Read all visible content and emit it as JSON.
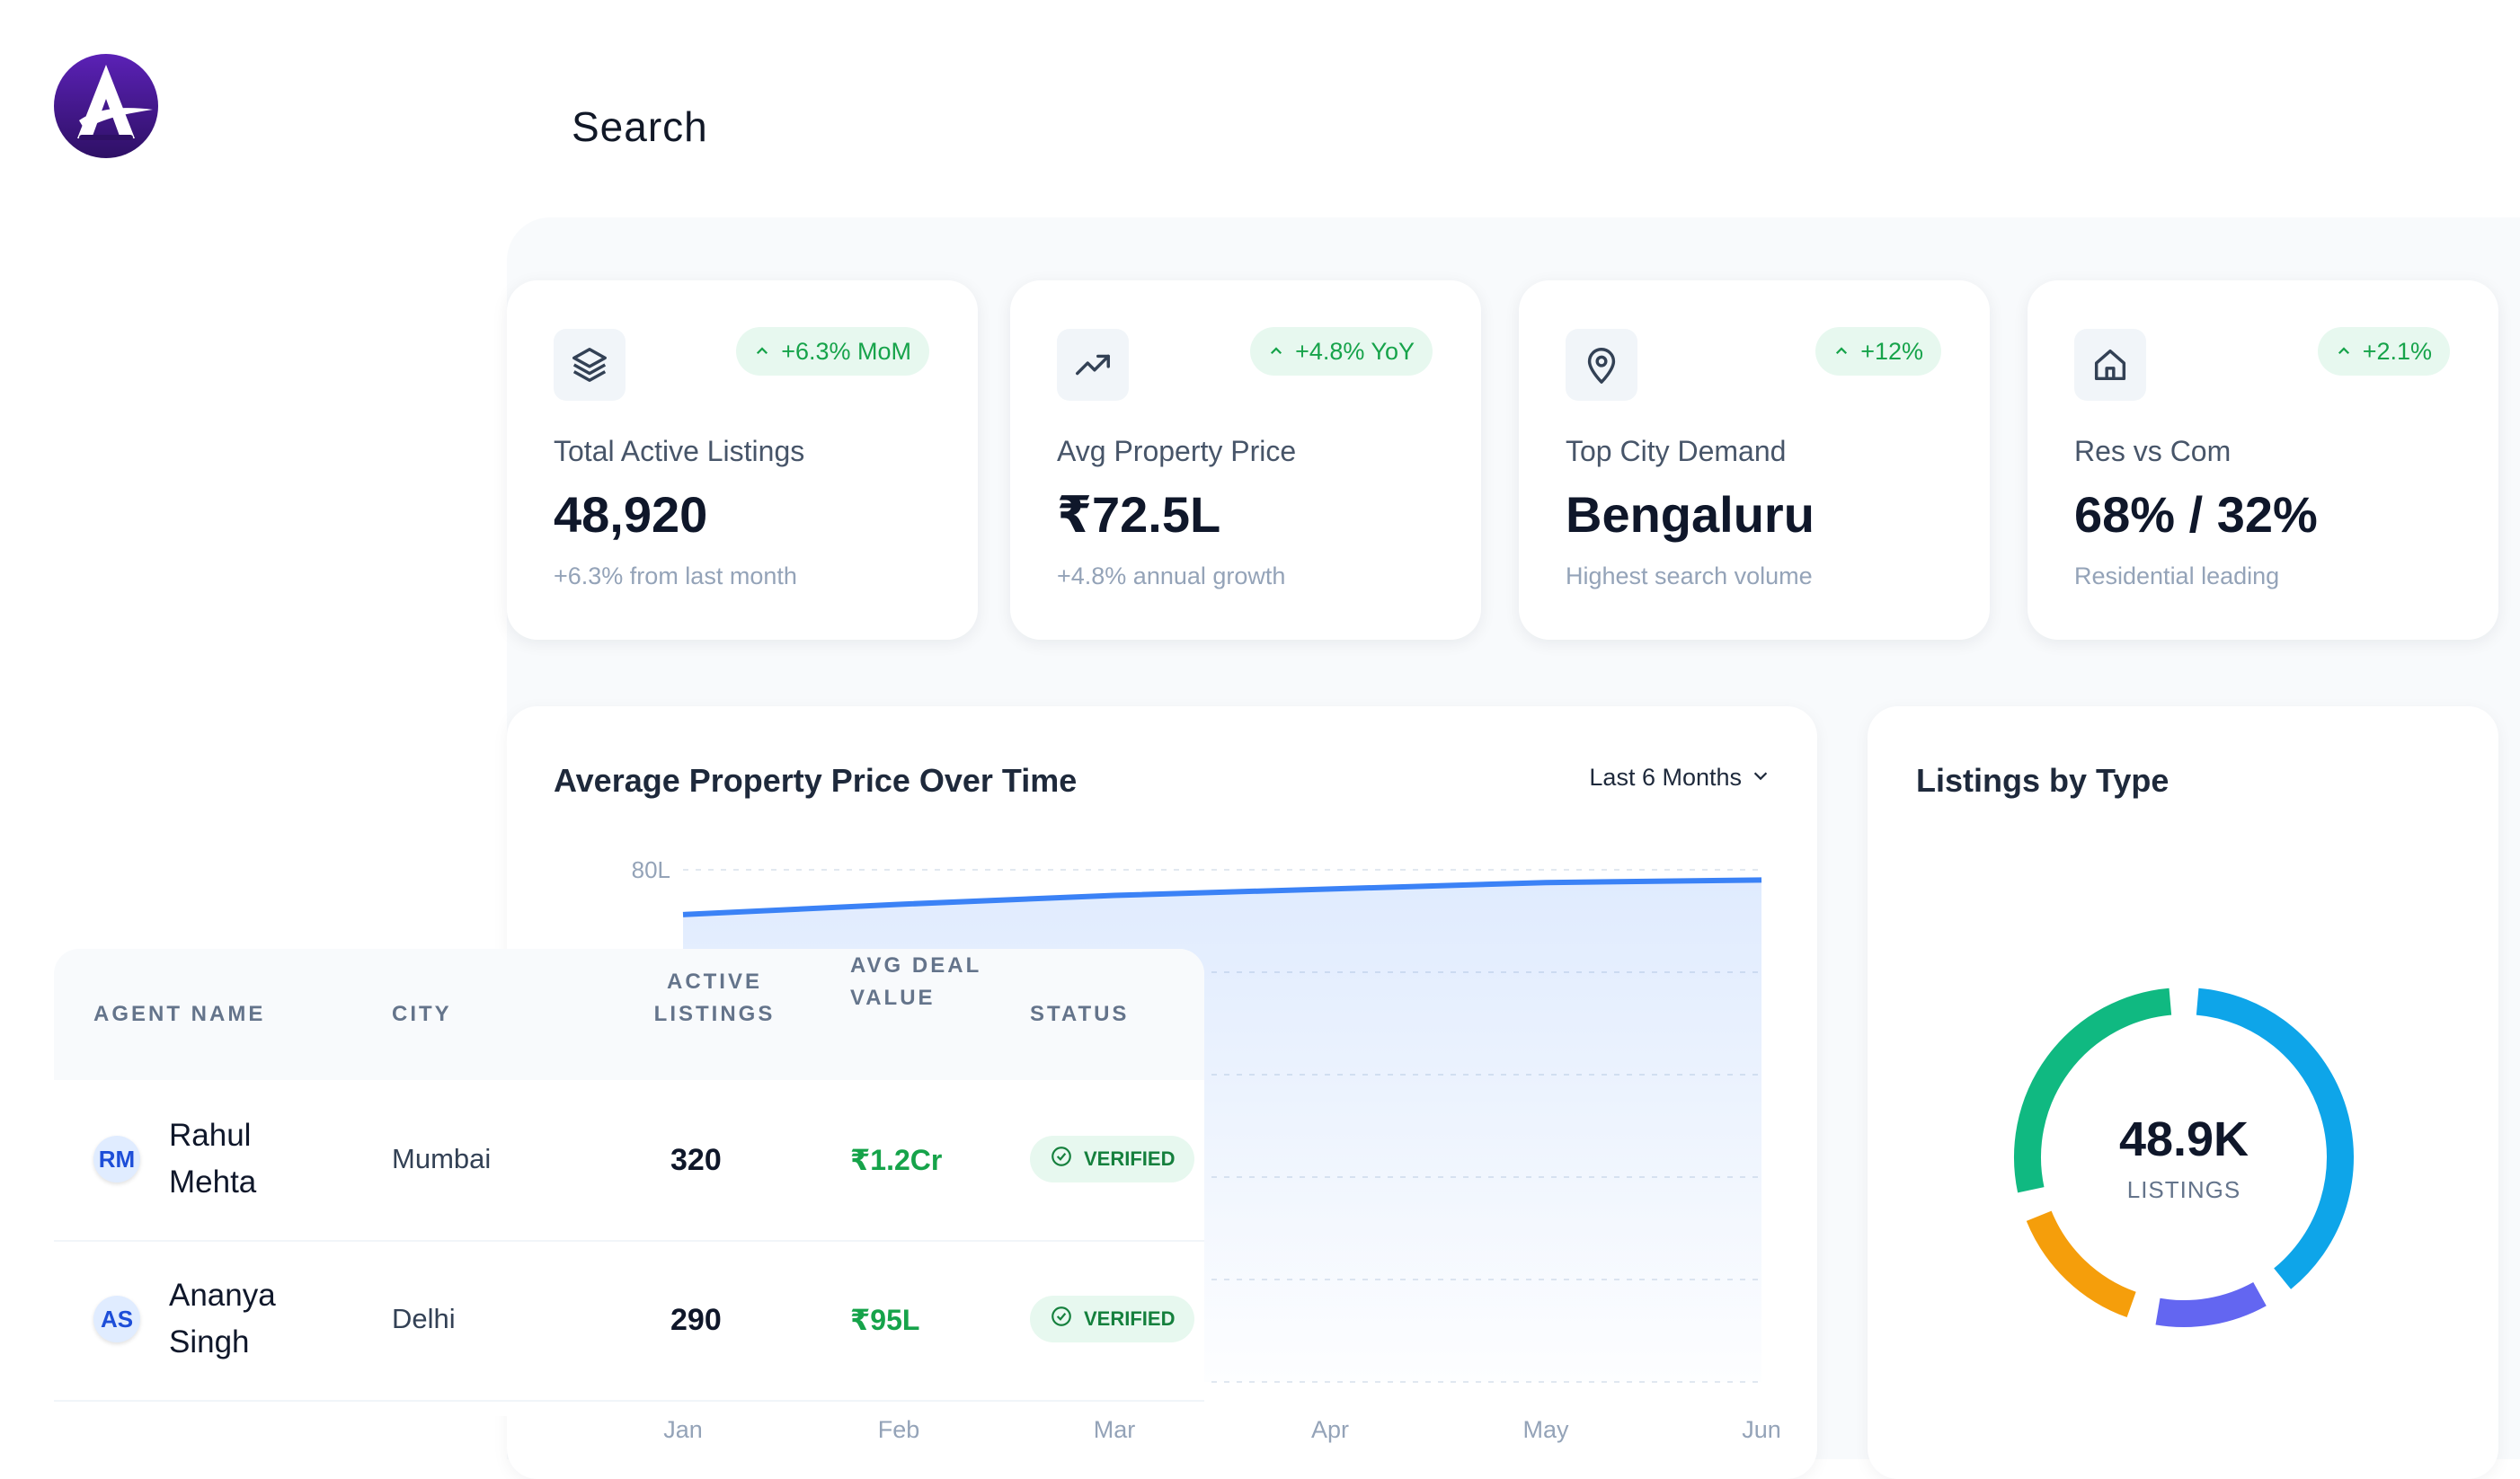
{
  "header": {
    "search_label": "Search"
  },
  "kpis": [
    {
      "icon": "layers-icon",
      "badge": "+6.3% MoM",
      "label": "Total Active Listings",
      "value": "48,920",
      "note": "+6.3% from last month"
    },
    {
      "icon": "trend-up-icon",
      "badge": "+4.8% YoY",
      "label": "Avg Property Price",
      "value": "₹72.5L",
      "note": "+4.8% annual growth"
    },
    {
      "icon": "map-pin-icon",
      "badge": "+12%",
      "label": "Top City Demand",
      "value": "Bengaluru",
      "note": "Highest search volume"
    },
    {
      "icon": "home-icon",
      "badge": "+2.1%",
      "label": "Res vs Com",
      "value": "68% / 32%",
      "note": "Residential leading"
    }
  ],
  "price_chart": {
    "title": "Average Property Price Over Time",
    "range": "Last 6 Months"
  },
  "chart_data": {
    "type": "area",
    "title": "Average Property Price Over Time",
    "categories": [
      "Jan",
      "Feb",
      "Mar",
      "Apr",
      "May",
      "Jun"
    ],
    "values": [
      76.5,
      77.3,
      78.0,
      78.5,
      79.0,
      79.2
    ],
    "y_tick_labels": [
      "80L"
    ],
    "y_unit": "L",
    "ylim": [
      40,
      80
    ],
    "grid": true,
    "color": "#3b82f6"
  },
  "type_chart": {
    "title": "Listings by Type",
    "total": "48.9K",
    "caption": "LISTINGS",
    "segments": [
      {
        "value": 30,
        "color": "#0ea5e9"
      },
      {
        "value": 10,
        "color": "#6366f1"
      },
      {
        "value": 12,
        "color": "#f59e0b"
      },
      {
        "value": 22,
        "color": "#10b981"
      }
    ]
  },
  "agents": {
    "columns": {
      "agent_name": "AGENT NAME",
      "city": "CITY",
      "active_listings": "ACTIVE LISTINGS",
      "avg_deal_value": "AVG DEAL VALUE",
      "status": "STATUS"
    },
    "rows": [
      {
        "initials": "RM",
        "name": "Rahul Mehta",
        "city": "Mumbai",
        "listings": "320",
        "deal": "₹1.2Cr",
        "status": "VERIFIED"
      },
      {
        "initials": "AS",
        "name": "Ananya Singh",
        "city": "Delhi",
        "listings": "290",
        "deal": "₹95L",
        "status": "VERIFIED"
      }
    ]
  },
  "colors": {
    "brand": "#4c1d95",
    "positive": "#16a34a",
    "accent": "#3b82f6"
  }
}
